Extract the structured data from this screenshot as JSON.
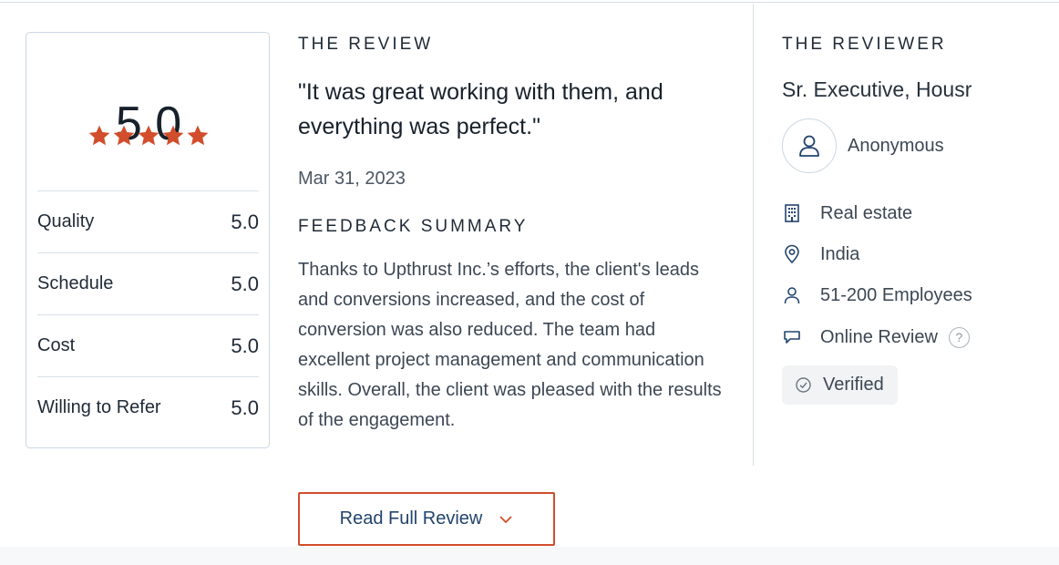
{
  "rating": {
    "overall": "5.0",
    "stars": 5,
    "star_color": "#d24d2b",
    "metrics": [
      {
        "label": "Quality",
        "value": "5.0"
      },
      {
        "label": "Schedule",
        "value": "5.0"
      },
      {
        "label": "Cost",
        "value": "5.0"
      },
      {
        "label": "Willing to Refer",
        "value": "5.0"
      }
    ]
  },
  "review": {
    "section_label": "THE REVIEW",
    "quote": "\"It was great working with them, and everything was perfect.\"",
    "date": "Mar 31, 2023",
    "summary_label": "FEEDBACK SUMMARY",
    "summary": "Thanks to Upthrust Inc.’s efforts, the client's leads and conversions increased, and the cost of conversion was also reduced. The team had excellent project management and communication skills. Overall, the client was pleased with the results of the engagement."
  },
  "read_more": {
    "label": "Read Full Review",
    "icon": "chevron-down-icon",
    "border_color": "#d24d2b"
  },
  "reviewer": {
    "section_label": "THE REVIEWER",
    "title": "Sr. Executive, Housr",
    "name": "Anonymous",
    "industry": {
      "icon": "building-icon",
      "text": "Real estate"
    },
    "location": {
      "icon": "location-pin-icon",
      "text": "India"
    },
    "company_size": {
      "icon": "person-icon",
      "text": "51-200 Employees"
    },
    "review_type": {
      "icon": "chat-bubble-icon",
      "text": "Online Review",
      "help_glyph": "?"
    },
    "verified": {
      "icon": "check-circle-icon",
      "text": "Verified"
    }
  }
}
